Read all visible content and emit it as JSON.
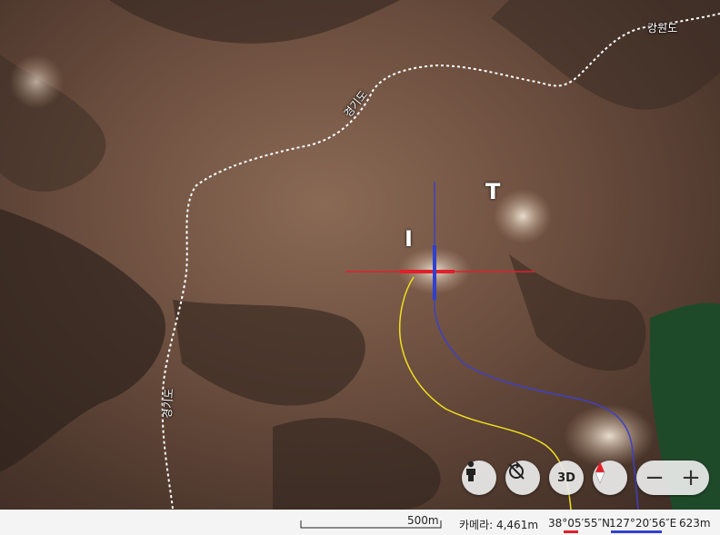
{
  "map": {
    "labels": {
      "gangwon": "강원도",
      "gyeonggi_top": "경기도",
      "gyeonggi_left": "경기도"
    },
    "markers": {
      "i": "I",
      "t": "T"
    },
    "colors": {
      "boundary": "#ffffff",
      "crosshair_h": "#e0202a",
      "crosshair_v": "#3040d0",
      "path_yellow": "#f0e020",
      "path_blue": "#4040c0",
      "forest": "#1f4a2a"
    }
  },
  "controls": {
    "street_view_icon": "person-icon",
    "rotate_icon": "rotate-icon",
    "three_d_label": "3D",
    "compass_icon": "compass-icon",
    "zoom_out": "−",
    "zoom_in": "+"
  },
  "status": {
    "scale_label": "500m",
    "camera": "카메라: 4,461m",
    "latitude": "38°05′55″N",
    "longitude": "127°20′56″E",
    "elevation": "623m"
  }
}
